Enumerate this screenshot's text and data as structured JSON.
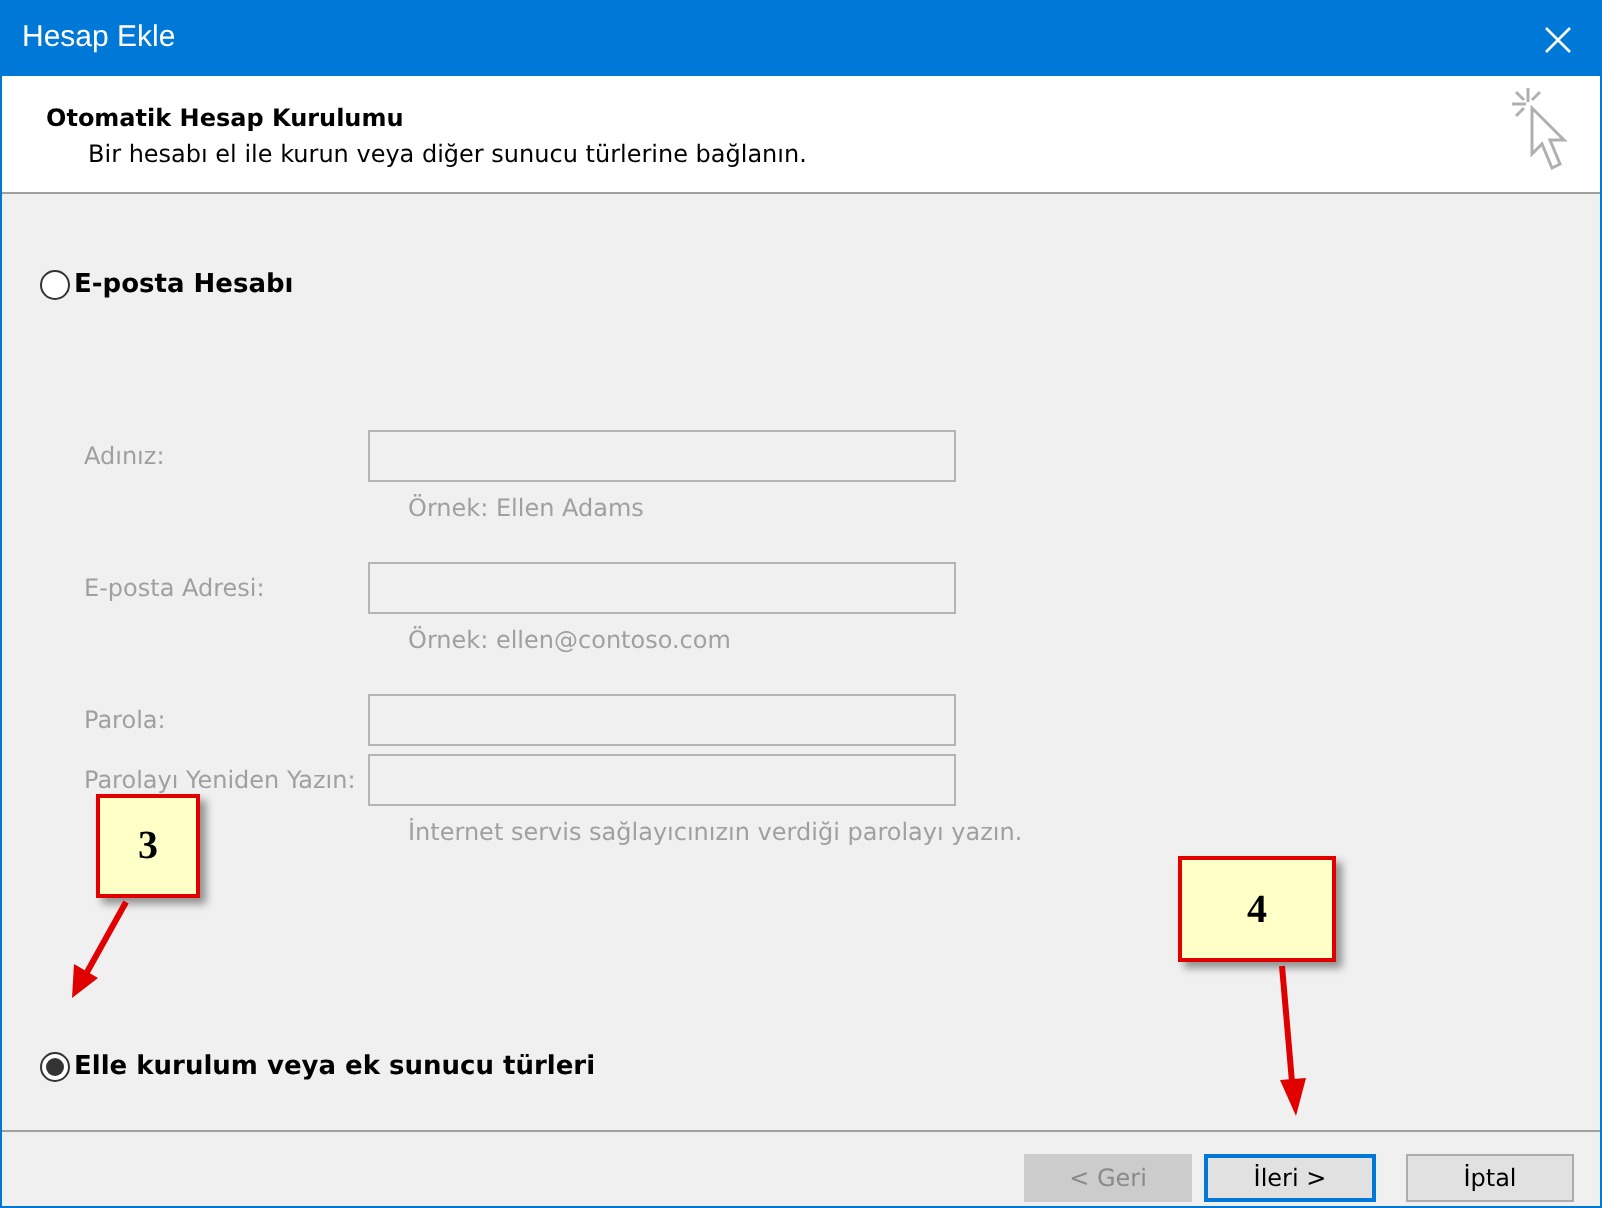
{
  "window": {
    "title": "Hesap Ekle"
  },
  "header": {
    "title": "Otomatik Hesap Kurulumu",
    "subtitle": "Bir hesabı el ile kurun veya diğer sunucu türlerine bağlanın."
  },
  "options": [
    {
      "label": "E-posta Hesabı",
      "selected": false
    },
    {
      "label": "Elle kurulum veya ek sunucu türleri",
      "selected": true
    }
  ],
  "fields": [
    {
      "label": "Adınız:",
      "hint": "Örnek: Ellen Adams",
      "disabled": true
    },
    {
      "label": "E-posta Adresi:",
      "hint": "Örnek: ellen@contoso.com",
      "disabled": true
    },
    {
      "label": "Parola:",
      "disabled": true
    },
    {
      "label": "Parolayı Yeniden Yazın:",
      "hint": "İnternet servis sağlayıcınızın verdiği parolayı yazın.",
      "disabled": true
    }
  ],
  "buttons": [
    {
      "label": "< Geri",
      "disabled": true,
      "selected": false
    },
    {
      "label": "İleri >",
      "disabled": false,
      "selected": true
    },
    {
      "label": "İptal",
      "disabled": false,
      "selected": false
    }
  ],
  "callouts": [
    {
      "label": "3"
    },
    {
      "label": "4"
    }
  ]
}
